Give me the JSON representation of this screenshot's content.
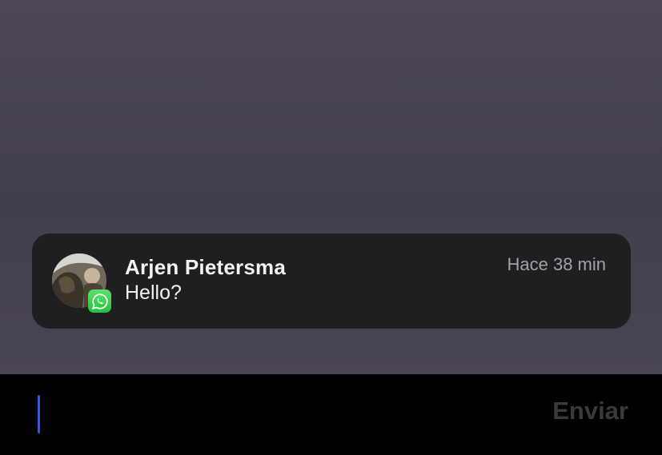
{
  "notification": {
    "sender": "Arjen Pietersma",
    "message": "Hello?",
    "time": "Hace 38 min",
    "app_icon": "whatsapp-icon",
    "avatar": "contact-photo"
  },
  "reply": {
    "placeholder": "",
    "value": "",
    "send_label": "Enviar"
  },
  "colors": {
    "background": "#4a4555",
    "card": "#1f1f21",
    "badge": "#25c23f",
    "cursor": "#3c55d8",
    "send_disabled": "#3a3a3c"
  }
}
